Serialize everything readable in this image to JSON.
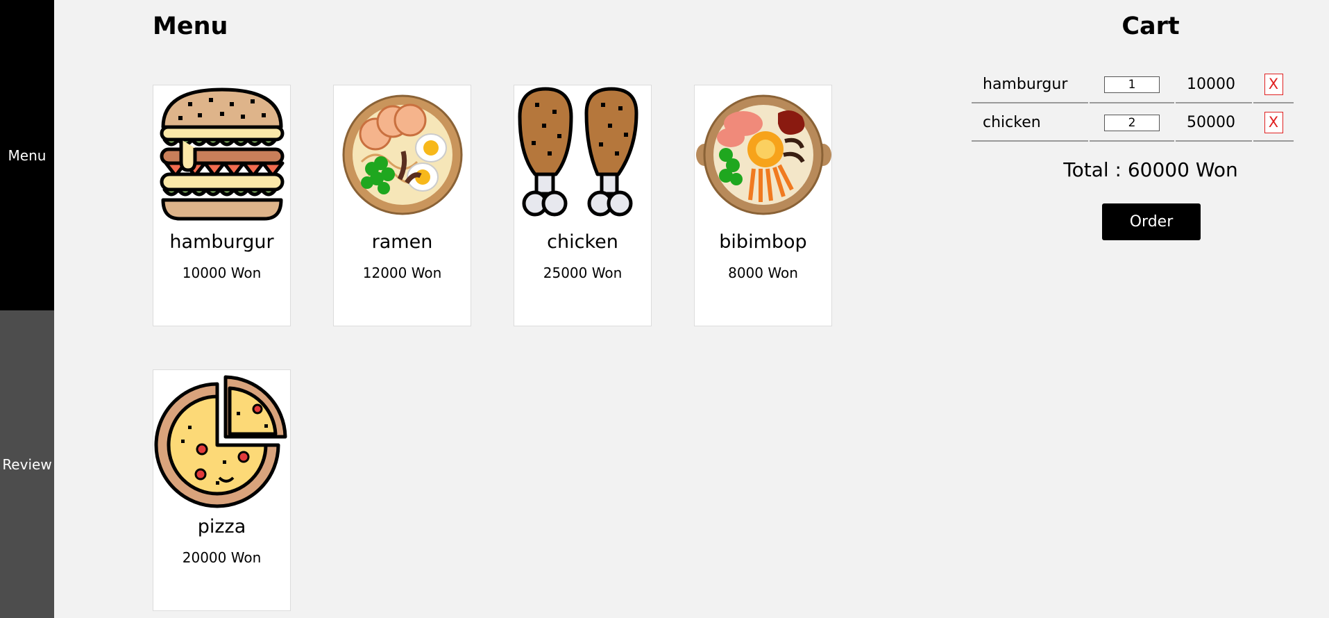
{
  "sidebar": {
    "items": [
      {
        "label": "Menu"
      },
      {
        "label": "Review"
      }
    ]
  },
  "menu": {
    "title": "Menu",
    "items": [
      {
        "name": "hamburgur",
        "price": "10000 Won",
        "icon": "hamburger-icon"
      },
      {
        "name": "ramen",
        "price": "12000 Won",
        "icon": "ramen-icon"
      },
      {
        "name": "chicken",
        "price": "25000 Won",
        "icon": "chicken-icon"
      },
      {
        "name": "bibimbop",
        "price": "8000 Won",
        "icon": "bibimbap-icon"
      },
      {
        "name": "pizza",
        "price": "20000 Won",
        "icon": "pizza-icon"
      }
    ]
  },
  "cart": {
    "title": "Cart",
    "rows": [
      {
        "name": "hamburgur",
        "qty": "1",
        "price": "10000",
        "remove_label": "X"
      },
      {
        "name": "chicken",
        "qty": "2",
        "price": "50000",
        "remove_label": "X"
      }
    ],
    "total": "Total : 60000 Won",
    "order_label": "Order"
  },
  "colors": {
    "background": "#f2f2f2",
    "sidebar_active": "#000000",
    "sidebar_inactive": "#4d4d4d",
    "remove_red": "#e02020",
    "order_button": "#000000"
  }
}
